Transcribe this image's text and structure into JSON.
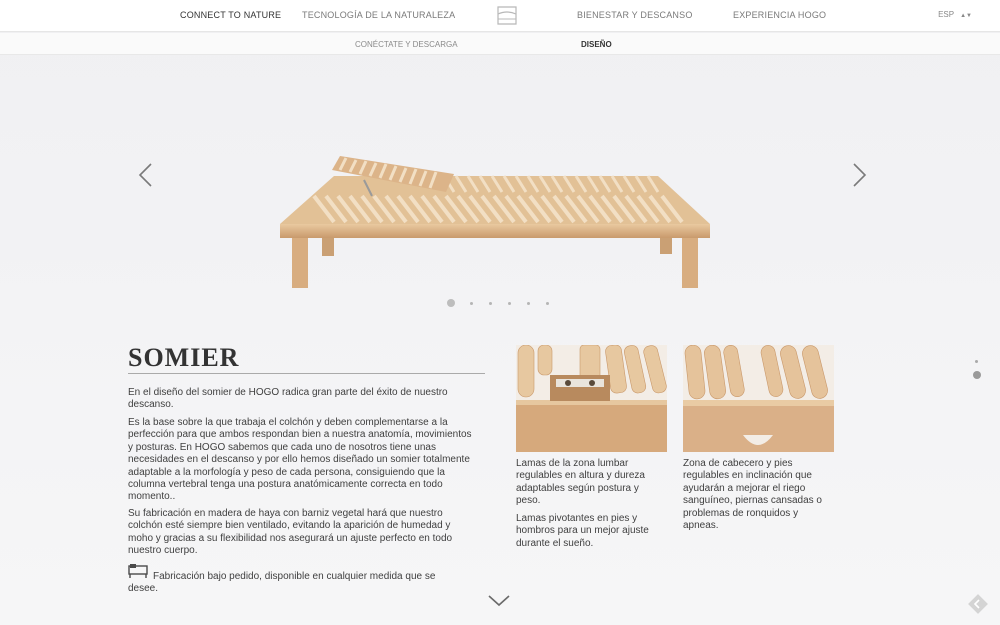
{
  "nav": {
    "items": [
      {
        "label": "CONNECT TO NATURE",
        "active": true
      },
      {
        "label": "TECNOLOGÍA DE LA NATURALEZA",
        "active": false
      },
      {
        "label": "BIENESTAR Y DESCANSO",
        "active": false
      },
      {
        "label": "EXPERIENCIA HOGO",
        "active": false
      }
    ],
    "logo_icon": "bed-frame-logo-icon",
    "language": "ESP"
  },
  "subnav": {
    "items": [
      {
        "label": "CONÉCTATE Y DESCARGA",
        "active": false
      },
      {
        "label": "DISEÑO",
        "active": true
      }
    ]
  },
  "slider": {
    "prev_icon": "chevron-left-icon",
    "next_icon": "chevron-right-icon",
    "slide_count": 6,
    "active_index": 0
  },
  "content": {
    "title": "SOMIER",
    "paragraphs": [
      "En el diseño del somier de HOGO radica gran parte del éxito de nuestro descanso.",
      "Es la base sobre la que trabaja el colchón y deben complementarse a la perfección para que ambos respondan bien a nuestra anatomía, movimientos y posturas. En HOGO sabemos que cada uno de nosotros tiene unas necesidades en el descanso y por ello hemos diseñado un somier totalmente adaptable a la morfología y peso de cada persona, consiguiendo que la columna vertebral tenga una postura anatómicamente correcta en todo momento..",
      "Su fabricación en madera de haya con barniz vegetal hará que nuestro colchón esté siempre bien ventilado, evitando la aparición de humedad y moho y gracias a su flexibilidad nos asegurará un ajuste perfecto en todo nuestro cuerpo."
    ],
    "feature": "Fabricación bajo pedido, disponible en cualquier medida que se desee.",
    "feature_icon": "bed-made-to-order-icon"
  },
  "details": [
    {
      "caption_1": "Lamas de la zona lumbar regulables en altura y dureza adaptables según postura y peso.",
      "caption_2": "Lamas pivotantes en pies y hombros para un mejor ajuste durante el sueño."
    },
    {
      "caption_1": "Zona de cabecero y pies regulables en inclinación que ayudarán a mejorar el riego sanguíneo, piernas cansadas o problemas de ronquidos y apneas."
    }
  ],
  "side_nav": {
    "count": 2,
    "active_index": 1
  },
  "scroll_down_icon": "chevron-down-icon",
  "corner_icon": "back-arrow-badge-icon",
  "colors": {
    "wood": "#dcb489",
    "wood_dark": "#c9986a",
    "text": "#3f3f3f"
  }
}
